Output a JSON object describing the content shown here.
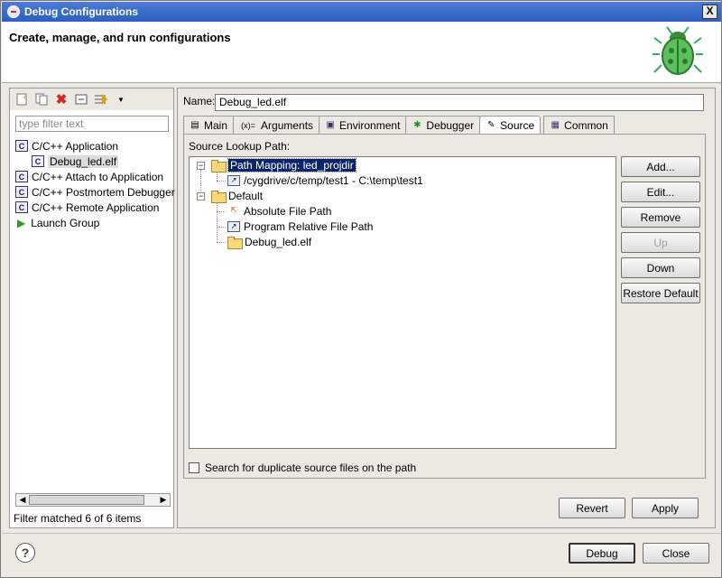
{
  "window": {
    "title": "Debug Configurations",
    "close_glyph": "X"
  },
  "header": {
    "title": "Create, manage, and run configurations"
  },
  "left": {
    "filter_placeholder": "type filter text",
    "tree": [
      {
        "label": "C/C++ Application"
      },
      {
        "label": "Debug_led.elf"
      },
      {
        "label": "C/C++ Attach to Application"
      },
      {
        "label": "C/C++ Postmortem Debugger"
      },
      {
        "label": "C/C++ Remote Application"
      },
      {
        "label": "Launch Group"
      }
    ],
    "status": "Filter matched 6 of 6 items"
  },
  "right": {
    "name_label": "Name:",
    "name_value": "Debug_led.elf",
    "tabs": [
      {
        "label": "Main",
        "icon": "main-icon"
      },
      {
        "label": "Arguments",
        "icon": "arguments-icon"
      },
      {
        "label": "Environment",
        "icon": "environment-icon"
      },
      {
        "label": "Debugger",
        "icon": "debugger-icon"
      },
      {
        "label": "Source",
        "icon": "source-icon"
      },
      {
        "label": "Common",
        "icon": "common-icon"
      }
    ],
    "active_tab": "Source",
    "source_lookup_label": "Source Lookup Path:",
    "lookup_tree": [
      {
        "label": "Path Mapping: led_projdir"
      },
      {
        "label": "/cygdrive/c/temp/test1 - C:\\temp\\test1"
      },
      {
        "label": "Default"
      },
      {
        "label": "Absolute File Path"
      },
      {
        "label": "Program Relative File Path"
      },
      {
        "label": "Debug_led.elf"
      }
    ],
    "buttons": {
      "add": "Add...",
      "edit": "Edit...",
      "remove": "Remove",
      "up": "Up",
      "down": "Down",
      "restore": "Restore Default"
    },
    "search_dup_label": "Search for duplicate source files on the path",
    "revert": "Revert",
    "apply": "Apply"
  },
  "footer": {
    "help": "?",
    "debug": "Debug",
    "close": "Close"
  }
}
